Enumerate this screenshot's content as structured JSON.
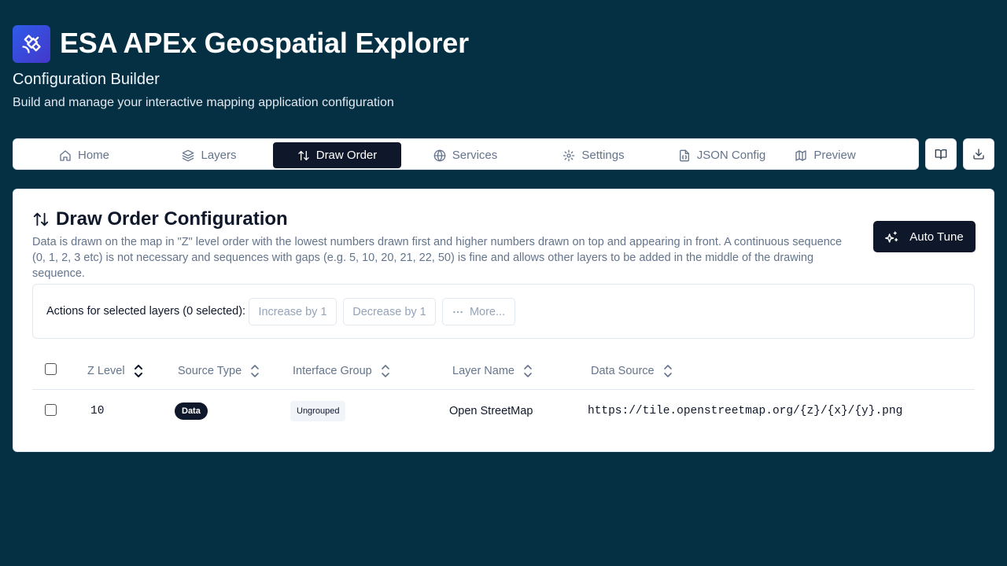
{
  "app": {
    "title": "ESA APEx Geospatial Explorer",
    "subtitle": "Configuration Builder",
    "tagline": "Build and manage your interactive mapping application configuration",
    "logo_icon": "satellite-icon"
  },
  "tabs": [
    {
      "label": "Home",
      "icon": "home-icon"
    },
    {
      "label": "Layers",
      "icon": "layers-icon"
    },
    {
      "label": "Draw Order",
      "icon": "arrow-up-down-icon",
      "active": true
    },
    {
      "label": "Services",
      "icon": "globe-icon"
    },
    {
      "label": "Settings",
      "icon": "gear-icon"
    },
    {
      "label": "JSON Config",
      "icon": "file-json-icon"
    },
    {
      "label": "Preview",
      "icon": "map-icon"
    }
  ],
  "toolbar": {
    "docs_icon": "book-open-icon",
    "download_icon": "download-icon"
  },
  "card": {
    "title": "Draw Order Configuration",
    "description": "Data is drawn on the map in \"Z\" level order with the lowest numbers drawn first and higher numbers drawn on top and appearing in front. A continuous sequence (0, 1, 2, 3 etc) is not necessary and sequences with gaps (e.g. 5, 10, 20, 21, 22, 50) is fine and allows other layers to be added in the middle of the drawing sequence.",
    "auto_tune_label": "Auto Tune"
  },
  "actions": {
    "label": "Actions for selected layers (0 selected):",
    "increase_label": "Increase by 1",
    "decrease_label": "Decrease by 1",
    "more_label": "More..."
  },
  "table": {
    "headers": [
      "Z Level",
      "Source Type",
      "Interface Group",
      "Layer Name",
      "Data Source"
    ],
    "rows": [
      {
        "z_level": "10",
        "source_type": "Data",
        "interface_group": "Ungrouped",
        "layer_name": "Open StreetMap",
        "data_source": "https://tile.openstreetmap.org/{z}/{x}/{y}.png"
      }
    ]
  },
  "colors": {
    "background": "#053043",
    "primary": "#0f172a",
    "logo_accent": "#3b5bdb"
  }
}
